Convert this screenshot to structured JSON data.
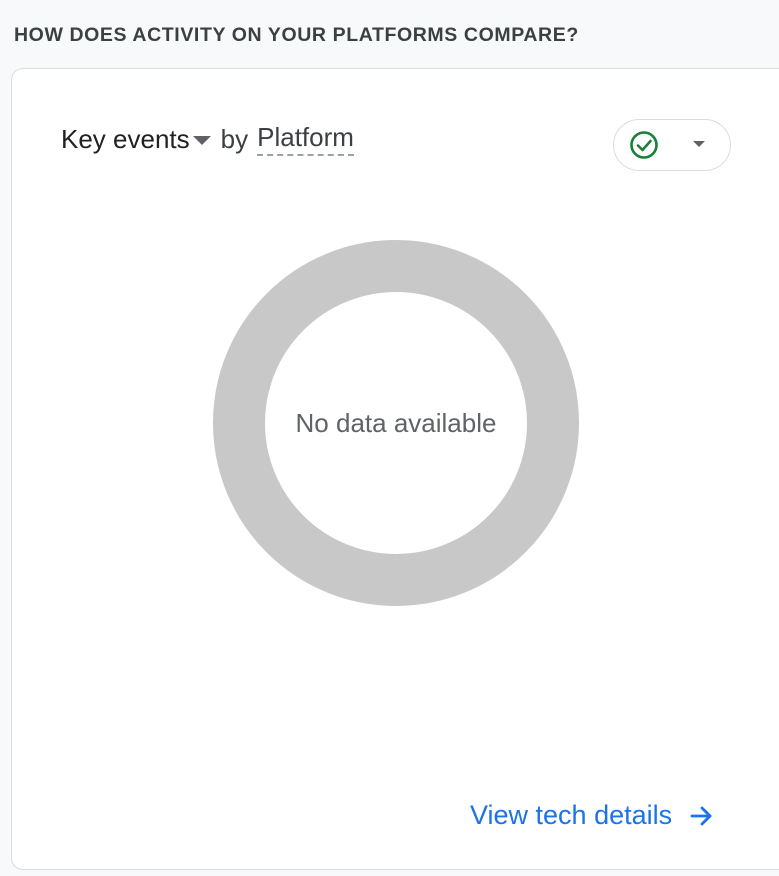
{
  "section": {
    "heading": "HOW DOES ACTIVITY ON YOUR PLATFORMS COMPARE?"
  },
  "card": {
    "metric": "Key events",
    "by": "by",
    "dimension": "Platform",
    "compare_icon": "check-circle-icon",
    "empty_message": "No data available",
    "link_label": "View tech details",
    "link_icon": "arrow-right-icon"
  },
  "colors": {
    "link": "#1a73e8",
    "check": "#188038",
    "donut_empty": "#c8c8c8"
  }
}
